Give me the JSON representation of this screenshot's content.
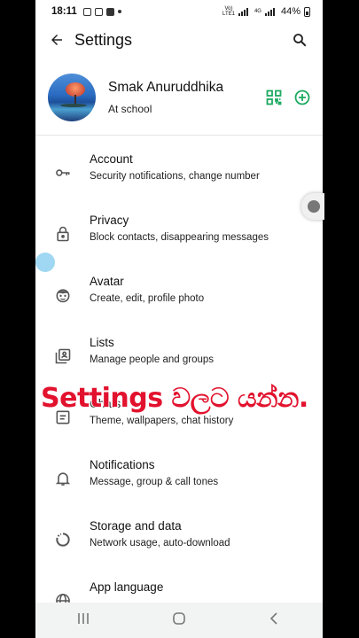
{
  "statusbar": {
    "time": "18:11",
    "battery": "44%",
    "network": "4G"
  },
  "appbar": {
    "title": "Settings"
  },
  "profile": {
    "name": "Smak Anuruddhika",
    "status": "At school"
  },
  "menu": [
    {
      "title": "Account",
      "subtitle": "Security notifications, change number",
      "icon": "key-icon"
    },
    {
      "title": "Privacy",
      "subtitle": "Block contacts, disappearing messages",
      "icon": "lock-icon"
    },
    {
      "title": "Avatar",
      "subtitle": "Create, edit, profile photo",
      "icon": "avatar-face-icon"
    },
    {
      "title": "Lists",
      "subtitle": "Manage people and groups",
      "icon": "lists-icon"
    },
    {
      "title": "Chats",
      "subtitle": "Theme, wallpapers, chat history",
      "icon": "chat-icon"
    },
    {
      "title": "Notifications",
      "subtitle": "Message, group & call tones",
      "icon": "bell-icon"
    },
    {
      "title": "Storage and data",
      "subtitle": "Network usage, auto-download",
      "icon": "storage-icon"
    },
    {
      "title": "App language",
      "subtitle": "",
      "icon": "globe-icon"
    }
  ],
  "overlay": {
    "caption": "Settings වලට යන්න."
  },
  "colors": {
    "accent": "#1daa61",
    "caption": "#e2122e"
  }
}
